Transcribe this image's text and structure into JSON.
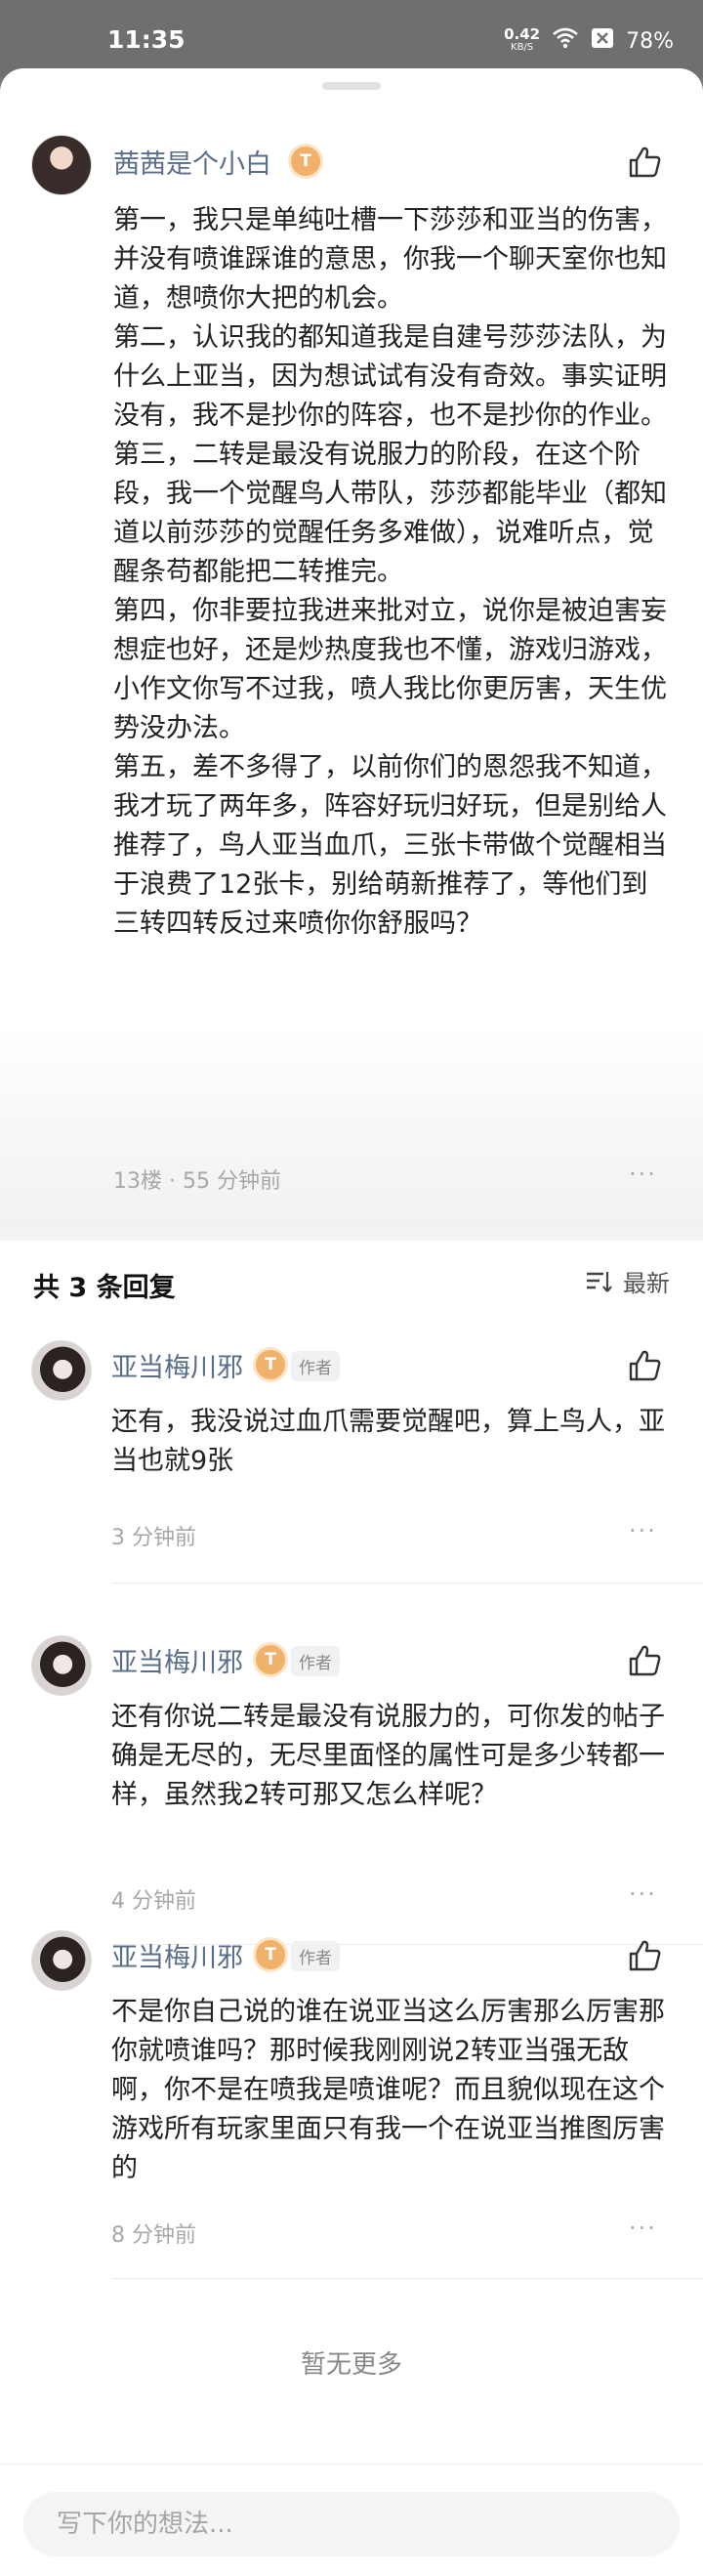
{
  "status_bar": {
    "time": "11:35",
    "net_speed_value": "0.42",
    "net_speed_unit": "KB/S",
    "battery": "78%"
  },
  "main_comment": {
    "username": "茜茜是个小白",
    "level_badge": "T",
    "paragraphs": [
      "第一，我只是单纯吐槽一下莎莎和亚当的伤害，并没有喷谁踩谁的意思，你我一个聊天室你也知道，想喷你大把的机会。",
      "第二，认识我的都知道我是自建号莎莎法队，为什么上亚当，因为想试试有没有奇效。事实证明没有，我不是抄你的阵容，也不是抄你的作业。",
      "第三，二转是最没有说服力的阶段，在这个阶段，我一个觉醒鸟人带队，莎莎都能毕业（都知道以前莎莎的觉醒任务多难做），说难听点，觉醒条苟都能把二转推完。",
      "第四，你非要拉我进来批对立，说你是被迫害妄想症也好，还是炒热度我也不懂，游戏归游戏，小作文你写不过我，喷人我比你更厉害，天生优势没办法。",
      "第五，差不多得了，以前你们的恩怨我不知道，我才玩了两年多，阵容好玩归好玩，但是别给人推荐了，鸟人亚当血爪，三张卡带做个觉醒相当于浪费了12张卡，别给萌新推荐了，等他们到三转四转反过来喷你你舒服吗？"
    ],
    "meta": "13楼 · 55 分钟前",
    "more": "···"
  },
  "replies_header": {
    "title": "共 3 条回复",
    "sort_label": "最新"
  },
  "replies": [
    {
      "username": "亚当梅川邪",
      "level_badge": "T",
      "author_tag": "作者",
      "text": "还有，我没说过血爪需要觉醒吧，算上鸟人，亚当也就9张",
      "meta": "3 分钟前",
      "more": "···"
    },
    {
      "username": "亚当梅川邪",
      "level_badge": "T",
      "author_tag": "作者",
      "text": "还有你说二转是最没有说服力的，可你发的帖子确是无尽的，无尽里面怪的属性可是多少转都一样，虽然我2转可那又怎么样呢？",
      "meta": "4 分钟前",
      "more": "···"
    },
    {
      "username": "亚当梅川邪",
      "level_badge": "T",
      "author_tag": "作者",
      "text": "不是你自己说的谁在说亚当这么厉害那么厉害那你就喷谁吗？那时候我刚刚说2转亚当强无敌啊，你不是在喷我是喷谁呢？而且貌似现在这个游戏所有玩家里面只有我一个在说亚当推图厉害的",
      "meta": "8 分钟前",
      "more": "···"
    }
  ],
  "no_more_text": "暂无更多",
  "compose": {
    "placeholder": "写下你的想法..."
  }
}
